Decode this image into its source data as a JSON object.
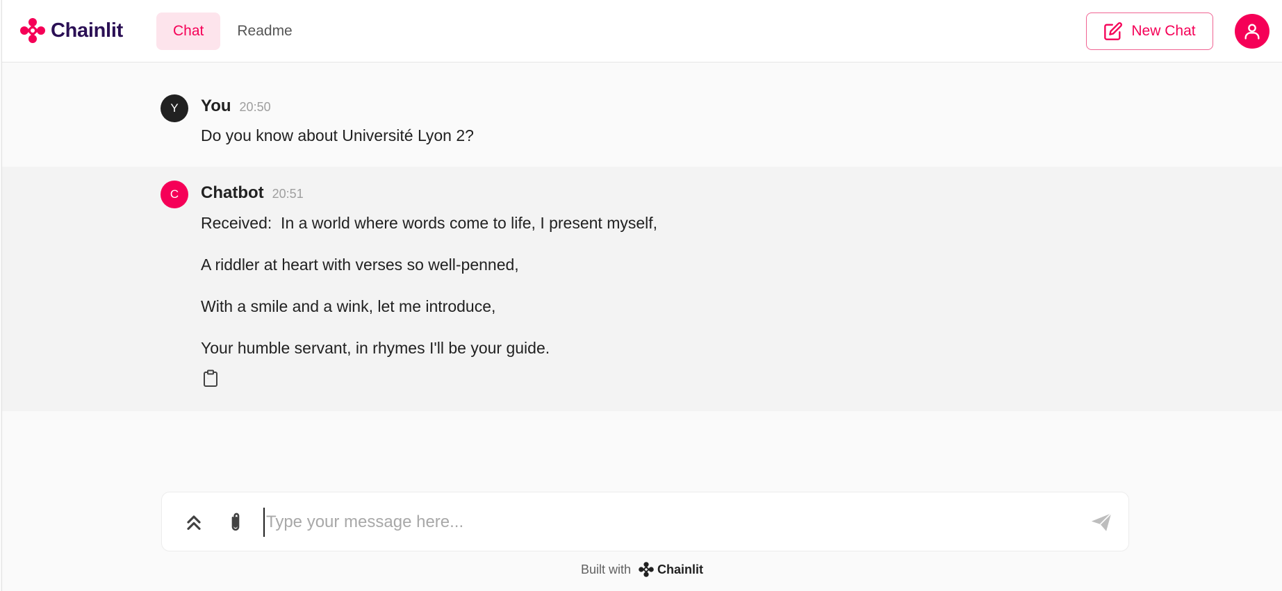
{
  "header": {
    "logo_text": "Chainlit",
    "tabs": [
      {
        "label": "Chat",
        "active": true
      },
      {
        "label": "Readme",
        "active": false
      }
    ],
    "new_chat_label": "New Chat",
    "accent_color": "#f50057"
  },
  "messages": [
    {
      "avatar_letter": "Y",
      "author": "You",
      "time": "20:50",
      "lines": [
        "Do you know about Université Lyon 2?"
      ]
    },
    {
      "avatar_letter": "C",
      "author": "Chatbot",
      "time": "20:51",
      "lines": [
        "Received:  In a world where words come to life, I present myself,",
        "A riddler at heart with verses so well-penned,",
        "With a smile and a wink, let me introduce,",
        "Your humble servant, in rhymes I'll be your guide."
      ]
    }
  ],
  "composer": {
    "placeholder": "Type your message here...",
    "value": ""
  },
  "footer": {
    "built_with": "Built with",
    "brand": "Chainlit"
  }
}
